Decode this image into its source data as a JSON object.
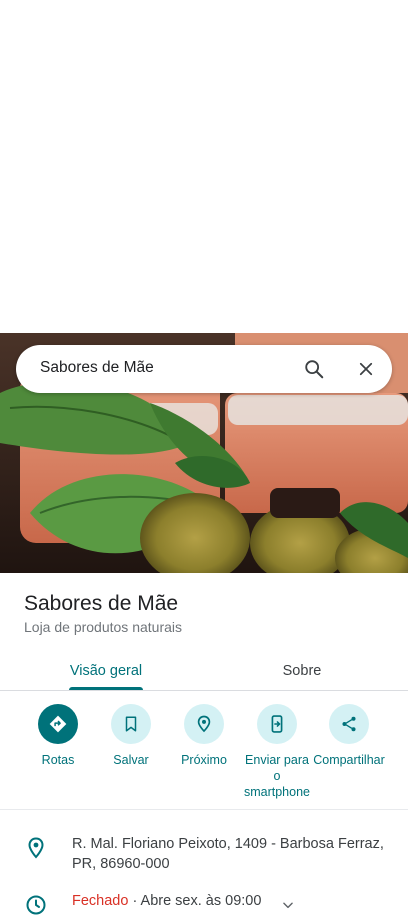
{
  "search": {
    "query": "Sabores de Mãe"
  },
  "place": {
    "name": "Sabores de Mãe",
    "category": "Loja de produtos naturais"
  },
  "tabs": [
    {
      "label": "Visão geral",
      "active": true
    },
    {
      "label": "Sobre",
      "active": false
    }
  ],
  "actions": [
    {
      "label": "Rotas",
      "icon": "directions-icon"
    },
    {
      "label": "Salvar",
      "icon": "bookmark-icon"
    },
    {
      "label": "Próximo",
      "icon": "nearby-icon"
    },
    {
      "label": "Enviar para o smartphone",
      "icon": "send-to-phone-icon"
    },
    {
      "label": "Compartilhar",
      "icon": "share-icon"
    }
  ],
  "info": {
    "address": "R. Mal. Floriano Peixoto, 1409 - Barbosa Ferraz, PR, 86960-000",
    "hours_status": "Fechado",
    "hours_detail": " · Abre sex. às 09:00"
  },
  "colors": {
    "accent": "#00727a",
    "accent_light": "#d4f1f4",
    "closed": "#d93025"
  }
}
